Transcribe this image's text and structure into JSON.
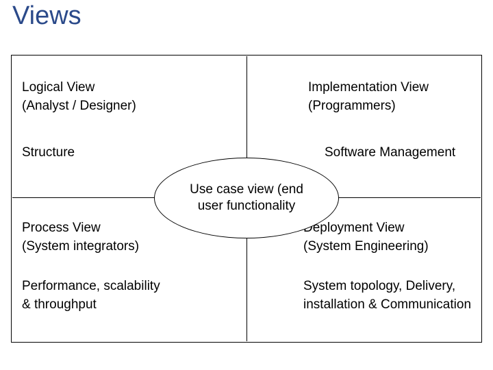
{
  "title": "Views",
  "center": {
    "line1": "Use case view (end",
    "line2": "user functionality"
  },
  "quadrants": {
    "tl": {
      "view_name": "Logical View",
      "stakeholder": "(Analyst / Designer)",
      "concern": "Structure"
    },
    "tr": {
      "view_name": "Implementation View",
      "stakeholder": "(Programmers)",
      "concern": "Software Management"
    },
    "bl": {
      "view_name": "Process View",
      "stakeholder": "(System integrators)",
      "concern_line1": "Performance, scalability",
      "concern_line2": "& throughput"
    },
    "br": {
      "view_name": "Deployment View",
      "stakeholder": "(System Engineering)",
      "concern_line1": "System topology, Delivery,",
      "concern_line2": "installation & Communication"
    }
  }
}
